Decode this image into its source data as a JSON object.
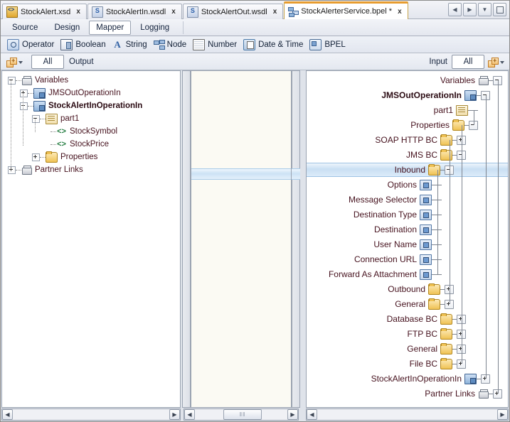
{
  "window": {
    "tabs": [
      {
        "label": "StockAlert.xsd",
        "icon": "xsd-file-icon",
        "active": false,
        "modified": false
      },
      {
        "label": "StockAlertIn.wsdl",
        "icon": "wsdl-file-icon",
        "active": false,
        "modified": false
      },
      {
        "label": "StockAlertOut.wsdl",
        "icon": "wsdl-file-icon",
        "active": false,
        "modified": false
      },
      {
        "label": "StockAlerterService.bpel *",
        "icon": "bpel-file-icon",
        "active": true,
        "modified": true
      }
    ],
    "close_glyph": "x",
    "nav_buttons": [
      {
        "name": "scroll-tabs-left-button",
        "glyph": "◀"
      },
      {
        "name": "scroll-tabs-right-button",
        "glyph": "▶"
      },
      {
        "name": "tab-list-dropdown-button",
        "glyph": "▼"
      },
      {
        "name": "maximize-editor-button",
        "glyph": "□"
      }
    ],
    "active_tab_accent": "#e79c2e"
  },
  "editor_tabs": {
    "items": [
      {
        "label": "Source",
        "active": false
      },
      {
        "label": "Design",
        "active": false
      },
      {
        "label": "Mapper",
        "active": true
      },
      {
        "label": "Logging",
        "active": false
      }
    ]
  },
  "palette": {
    "items": [
      {
        "label": "Operator",
        "icon": "operator-icon"
      },
      {
        "label": "Boolean",
        "icon": "boolean-icon"
      },
      {
        "label": "String",
        "icon": "string-icon",
        "glyph": "A"
      },
      {
        "label": "Node",
        "icon": "node-icon"
      },
      {
        "label": "Number",
        "icon": "number-icon"
      },
      {
        "label": "Date & Time",
        "icon": "date-time-icon"
      },
      {
        "label": "BPEL",
        "icon": "bpel-icon"
      }
    ]
  },
  "io_bar": {
    "left_add_icon": "add-output-icon",
    "left_scope": "All",
    "left_label": "Output",
    "right_label": "Input",
    "right_scope": "All",
    "right_add_icon": "add-input-icon"
  },
  "left_tree": {
    "rows": [
      {
        "label": "Variables",
        "icon": "variable-root-icon",
        "depth": 0,
        "expander": "minus",
        "bold": false
      },
      {
        "label": "JMSOutOperationIn",
        "icon": "message-icon",
        "depth": 1,
        "expander": "plus",
        "bold": false
      },
      {
        "label": "StockAlertInOperationIn",
        "icon": "message-icon",
        "depth": 1,
        "expander": "minus",
        "bold": true
      },
      {
        "label": "part1",
        "icon": "part-icon",
        "depth": 2,
        "expander": "minus",
        "bold": false
      },
      {
        "label": "StockSymbol",
        "icon": "element-icon",
        "depth": 3,
        "expander": "none",
        "bold": false
      },
      {
        "label": "StockPrice",
        "icon": "element-icon",
        "depth": 3,
        "expander": "none",
        "bold": false
      },
      {
        "label": "Properties",
        "icon": "folder-icon",
        "depth": 2,
        "expander": "plus",
        "bold": false
      },
      {
        "label": "Partner Links",
        "icon": "variable-root-icon",
        "depth": 0,
        "expander": "plus",
        "bold": false
      }
    ]
  },
  "right_tree": {
    "rows": [
      {
        "label": "Variables",
        "icon": "variable-root-icon",
        "depth": 0,
        "expander": "minus",
        "bold": false,
        "selected": false
      },
      {
        "label": "JMSOutOperationIn",
        "icon": "message-icon",
        "depth": 1,
        "expander": "minus",
        "bold": true,
        "selected": false
      },
      {
        "label": "part1",
        "icon": "part-icon",
        "depth": 2,
        "expander": "none",
        "bold": false,
        "selected": false
      },
      {
        "label": "Properties",
        "icon": "folder-icon",
        "depth": 2,
        "expander": "minus",
        "bold": false,
        "selected": false
      },
      {
        "label": "SOAP HTTP BC",
        "icon": "folder-icon",
        "depth": 3,
        "expander": "plus",
        "bold": false,
        "selected": false
      },
      {
        "label": "JMS BC",
        "icon": "folder-icon",
        "depth": 3,
        "expander": "minus",
        "bold": false,
        "selected": false
      },
      {
        "label": "Inbound",
        "icon": "folder-icon",
        "depth": 4,
        "expander": "minus",
        "bold": false,
        "selected": true
      },
      {
        "label": "Options",
        "icon": "leaf-property-icon",
        "depth": 5,
        "expander": "none",
        "bold": false,
        "selected": false
      },
      {
        "label": "Message Selector",
        "icon": "leaf-property-icon",
        "depth": 5,
        "expander": "none",
        "bold": false,
        "selected": false
      },
      {
        "label": "Destination Type",
        "icon": "leaf-property-icon",
        "depth": 5,
        "expander": "none",
        "bold": false,
        "selected": false
      },
      {
        "label": "Destination",
        "icon": "leaf-property-icon",
        "depth": 5,
        "expander": "none",
        "bold": false,
        "selected": false
      },
      {
        "label": "User Name",
        "icon": "leaf-property-icon",
        "depth": 5,
        "expander": "none",
        "bold": false,
        "selected": false
      },
      {
        "label": "Connection URL",
        "icon": "leaf-property-icon",
        "depth": 5,
        "expander": "none",
        "bold": false,
        "selected": false
      },
      {
        "label": "Forward As Attachment",
        "icon": "leaf-property-icon",
        "depth": 5,
        "expander": "none",
        "bold": false,
        "selected": false
      },
      {
        "label": "Outbound",
        "icon": "folder-icon",
        "depth": 4,
        "expander": "plus",
        "bold": false,
        "selected": false
      },
      {
        "label": "General",
        "icon": "folder-icon",
        "depth": 4,
        "expander": "plus",
        "bold": false,
        "selected": false
      },
      {
        "label": "Database BC",
        "icon": "folder-icon",
        "depth": 3,
        "expander": "plus",
        "bold": false,
        "selected": false
      },
      {
        "label": "FTP BC",
        "icon": "folder-icon",
        "depth": 3,
        "expander": "plus",
        "bold": false,
        "selected": false
      },
      {
        "label": "General",
        "icon": "folder-icon",
        "depth": 3,
        "expander": "plus",
        "bold": false,
        "selected": false
      },
      {
        "label": "File BC",
        "icon": "folder-icon",
        "depth": 3,
        "expander": "plus",
        "bold": false,
        "selected": false
      },
      {
        "label": "StockAlertInOperationIn",
        "icon": "message-icon",
        "depth": 1,
        "expander": "plus",
        "bold": false,
        "selected": false
      },
      {
        "label": "Partner Links",
        "icon": "variable-root-icon",
        "depth": 0,
        "expander": "plus",
        "bold": false,
        "selected": false
      }
    ]
  },
  "scrollbars": {
    "left_arrow_glyph": "◀",
    "right_arrow_glyph": "▶",
    "thumb_grip": "‖‖"
  }
}
